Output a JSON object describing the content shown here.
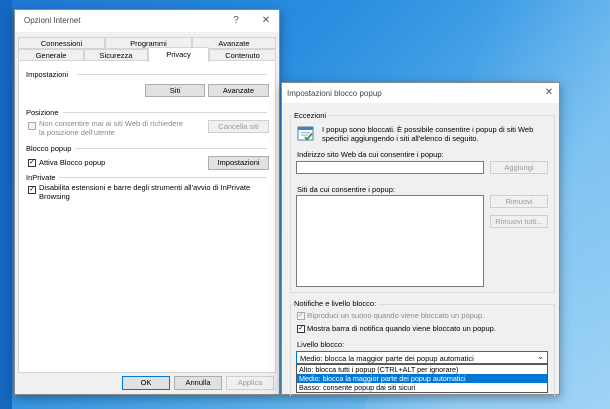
{
  "internet_options": {
    "title": "Opzioni Internet",
    "help_glyph": "?",
    "close_glyph": "✕",
    "tabs_row1": [
      "Connessioni",
      "Programmi",
      "Avanzate"
    ],
    "tabs_row2": [
      "Generale",
      "Sicurezza",
      "Privacy",
      "Contenuto"
    ],
    "impostazioni_label": "Impostazioni",
    "siti_btn": "Siti",
    "avanzate_btn": "Avanzate",
    "posizione_label": "Posizione",
    "posizione_check": "Non consentire mai ai siti Web di richiedere la posizione dell'utente",
    "cancella_siti_btn": "Cancella siti",
    "blocco_popup_label": "Blocco popup",
    "attiva_blocco": "Attiva Blocco popup",
    "impostazioni_btn": "Impostazioni",
    "inprivate_label": "InPrivate",
    "inprivate_check": "Disabilita estensioni e barre degli strumenti all'avvio di InPrivate Browsing",
    "ok_btn": "OK",
    "annulla_btn": "Annulla",
    "applica_btn": "Applica"
  },
  "popup_settings": {
    "title": "Impostazioni blocco popup",
    "close_glyph": "✕",
    "eccezioni_label": "Eccezioni",
    "info_text_1": "I popup sono bloccati. È possibile consentire i popup di siti Web",
    "info_text_2": "specifici aggiungendo i siti all'elenco di seguito.",
    "address_label": "Indirizzo sito Web da cui consentire i popup:",
    "address_value": "",
    "aggiungi_btn": "Aggiungi",
    "allowed_label": "Siti da cui consentire i popup:",
    "rimuovi_btn": "Rimuovi",
    "rimuovi_tutti_btn": "Rimuovi tutti...",
    "notifiche_label": "Notifiche e livello blocco:",
    "suono_check": "Riproduci un suono quando viene bloccato un popup.",
    "barra_check": "Mostra barra di notifica quando viene bloccato un popup.",
    "livello_label": "Livello blocco:",
    "livello_selected": "Medio: blocca la maggior parte dei popup automatici",
    "livello_options": [
      "Alto: blocca tutti i popup (CTRL+ALT per ignorare)",
      "Medio: blocca la maggior parte dei popup automatici",
      "Basso: consente popup dai siti sicuri"
    ]
  }
}
